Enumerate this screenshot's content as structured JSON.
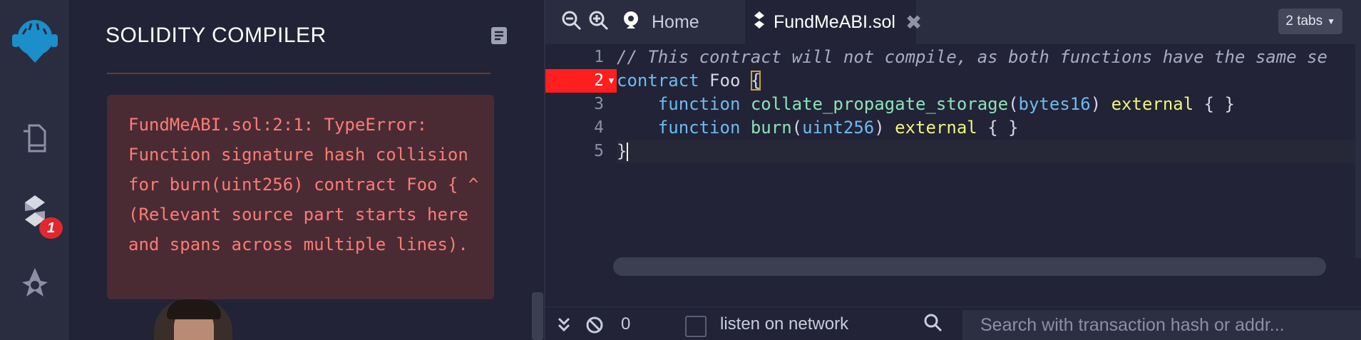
{
  "colors": {
    "background": "#222336",
    "panel_bg": "#2a2c3f",
    "error_text": "#ff7b73",
    "error_box_bg": "#4a2b34",
    "error_line": "#ff1f1f",
    "accent_blue": "#1a8fc9"
  },
  "sidebar": {
    "icons": [
      "remix-logo-icon",
      "file-explorer-icon",
      "solidity-compiler-icon",
      "deploy-run-icon"
    ],
    "compiler_badge": "1"
  },
  "panel": {
    "title": "SOLIDITY COMPILER",
    "error_message": "FundMeABI.sol:2:1: TypeError: Function signature hash collision for burn(uint256) contract Foo { ^ (Relevant source part starts here and spans across multiple lines)."
  },
  "editor": {
    "tabs": {
      "home_label": "Home",
      "active_label": "FundMeABI.sol",
      "count_label": "2 tabs"
    },
    "line_numbers": [
      "1",
      "2",
      "3",
      "4",
      "5"
    ],
    "error_line": "2",
    "code": {
      "line1_comment": "// This contract will not compile, as both functions have the same se",
      "line2_keyword": "contract",
      "line2_name": " Foo ",
      "line2_brace": "{",
      "line3_indent": "    ",
      "line3_keyword": "function",
      "line3_name": " collate_propagate_storage",
      "line3_open": "(",
      "line3_type": "bytes16",
      "line3_close": ") ",
      "line3_vis": "external",
      "line3_body": " { }",
      "line4_indent": "    ",
      "line4_keyword": "function",
      "line4_name": " burn",
      "line4_open": "(",
      "line4_type": "uint256",
      "line4_close": ") ",
      "line4_vis": "external",
      "line4_body": " { }",
      "line5_brace": "}"
    }
  },
  "terminal": {
    "tx_count": "0",
    "listen_label": "listen on network",
    "search_placeholder": "Search with transaction hash or addr..."
  }
}
